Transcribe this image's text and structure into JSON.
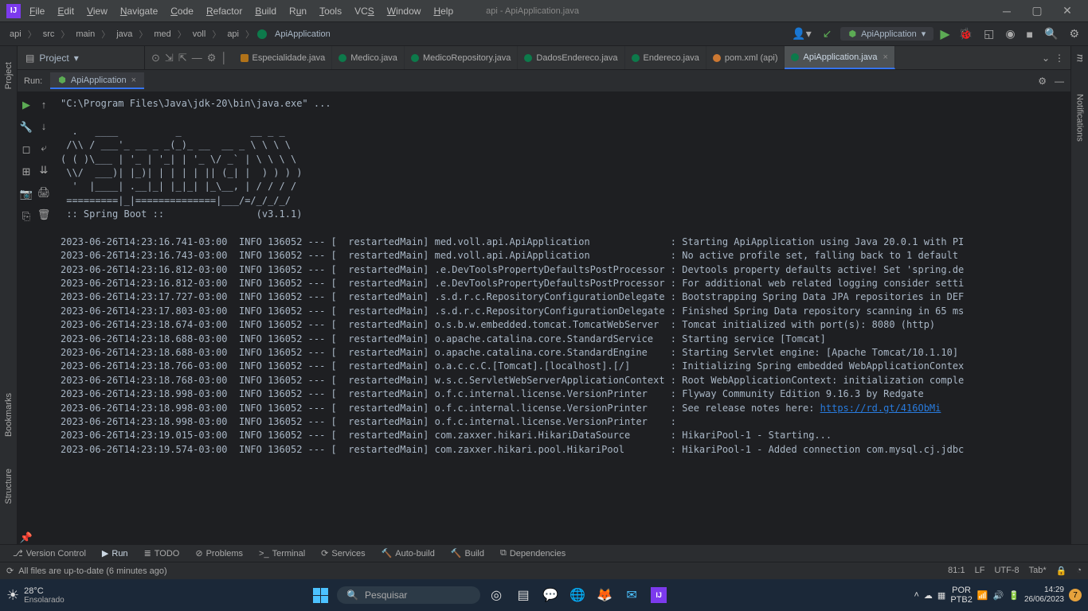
{
  "title": "api - ApiApplication.java",
  "menu": [
    "File",
    "Edit",
    "View",
    "Navigate",
    "Code",
    "Refactor",
    "Build",
    "Run",
    "Tools",
    "VCS",
    "Window",
    "Help"
  ],
  "breadcrumbs": [
    "api",
    "src",
    "main",
    "java",
    "med",
    "voll",
    "api",
    "ApiApplication"
  ],
  "runconfig": "ApiApplication",
  "project_label": "Project",
  "tabs": [
    {
      "label": "Especialidade.java",
      "icon": "j"
    },
    {
      "label": "Medico.java",
      "icon": "g"
    },
    {
      "label": "MedicoRepository.java",
      "icon": "g"
    },
    {
      "label": "DadosEndereco.java",
      "icon": "g"
    },
    {
      "label": "Endereco.java",
      "icon": "g"
    },
    {
      "label": "pom.xml (api)",
      "icon": "m"
    },
    {
      "label": "ApiApplication.java",
      "icon": "g",
      "active": true
    }
  ],
  "run_label": "Run:",
  "run_tab": "ApiApplication",
  "console_cmd": "\"C:\\Program Files\\Java\\jdk-20\\bin\\java.exe\" ...",
  "banner": "  .   ____          _            __ _ _\n /\\\\ / ___'_ __ _ _(_)_ __  __ _ \\ \\ \\ \\\n( ( )\\___ | '_ | '_| | '_ \\/ _` | \\ \\ \\ \\\n \\\\/  ___)| |_)| | | | | || (_| |  ) ) ) )\n  '  |____| .__|_| |_|_| |_\\__, | / / / /\n =========|_|==============|___/=/_/_/_/\n :: Spring Boot ::                (v3.1.1)",
  "log_lines": [
    "2023-06-26T14:23:16.741-03:00  INFO 136052 --- [  restartedMain] med.voll.api.ApiApplication              : Starting ApiApplication using Java 20.0.1 with PI",
    "2023-06-26T14:23:16.743-03:00  INFO 136052 --- [  restartedMain] med.voll.api.ApiApplication              : No active profile set, falling back to 1 default ",
    "2023-06-26T14:23:16.812-03:00  INFO 136052 --- [  restartedMain] .e.DevToolsPropertyDefaultsPostProcessor : Devtools property defaults active! Set 'spring.de",
    "2023-06-26T14:23:16.812-03:00  INFO 136052 --- [  restartedMain] .e.DevToolsPropertyDefaultsPostProcessor : For additional web related logging consider setti",
    "2023-06-26T14:23:17.727-03:00  INFO 136052 --- [  restartedMain] .s.d.r.c.RepositoryConfigurationDelegate : Bootstrapping Spring Data JPA repositories in DEF",
    "2023-06-26T14:23:17.803-03:00  INFO 136052 --- [  restartedMain] .s.d.r.c.RepositoryConfigurationDelegate : Finished Spring Data repository scanning in 65 ms",
    "2023-06-26T14:23:18.674-03:00  INFO 136052 --- [  restartedMain] o.s.b.w.embedded.tomcat.TomcatWebServer  : Tomcat initialized with port(s): 8080 (http)",
    "2023-06-26T14:23:18.688-03:00  INFO 136052 --- [  restartedMain] o.apache.catalina.core.StandardService   : Starting service [Tomcat]",
    "2023-06-26T14:23:18.688-03:00  INFO 136052 --- [  restartedMain] o.apache.catalina.core.StandardEngine    : Starting Servlet engine: [Apache Tomcat/10.1.10]",
    "2023-06-26T14:23:18.766-03:00  INFO 136052 --- [  restartedMain] o.a.c.c.C.[Tomcat].[localhost].[/]       : Initializing Spring embedded WebApplicationContex",
    "2023-06-26T14:23:18.768-03:00  INFO 136052 --- [  restartedMain] w.s.c.ServletWebServerApplicationContext : Root WebApplicationContext: initialization comple",
    "2023-06-26T14:23:18.998-03:00  INFO 136052 --- [  restartedMain] o.f.c.internal.license.VersionPrinter    : Flyway Community Edition 9.16.3 by Redgate",
    "2023-06-26T14:23:18.998-03:00  INFO 136052 --- [  restartedMain] o.f.c.internal.license.VersionPrinter    : See release notes here: ",
    "2023-06-26T14:23:18.998-03:00  INFO 136052 --- [  restartedMain] o.f.c.internal.license.VersionPrinter    : ",
    "2023-06-26T14:23:19.015-03:00  INFO 136052 --- [  restartedMain] com.zaxxer.hikari.HikariDataSource       : HikariPool-1 - Starting...",
    "2023-06-26T14:23:19.574-03:00  INFO 136052 --- [  restartedMain] com.zaxxer.hikari.pool.HikariPool        : HikariPool-1 - Added connection com.mysql.cj.jdbc"
  ],
  "link_url": "https://rd.gt/416ObMi",
  "bottom_tools": [
    {
      "icon": "⎇",
      "label": "Version Control"
    },
    {
      "icon": "▶",
      "label": "Run",
      "active": true
    },
    {
      "icon": "≣",
      "label": "TODO"
    },
    {
      "icon": "⊘",
      "label": "Problems"
    },
    {
      "icon": ">_",
      "label": "Terminal"
    },
    {
      "icon": "⟳",
      "label": "Services"
    },
    {
      "icon": "🔨",
      "label": "Auto-build"
    },
    {
      "icon": "🔨",
      "label": "Build"
    },
    {
      "icon": "⧉",
      "label": "Dependencies"
    }
  ],
  "status_msg": "All files are up-to-date (6 minutes ago)",
  "status_right": {
    "pos": "81:1",
    "sep": "LF",
    "enc": "UTF-8",
    "tab": "Tab*"
  },
  "left_tabs": [
    "Project",
    "Bookmarks",
    "Structure"
  ],
  "right_tabs": [
    "Maven",
    "Notifications"
  ],
  "weather": {
    "temp": "28°C",
    "desc": "Ensolarado"
  },
  "search_placeholder": "Pesquisar",
  "kbd": {
    "lang": "POR",
    "layout": "PTB2"
  },
  "clock": {
    "time": "14:29",
    "date": "26/06/2023"
  }
}
